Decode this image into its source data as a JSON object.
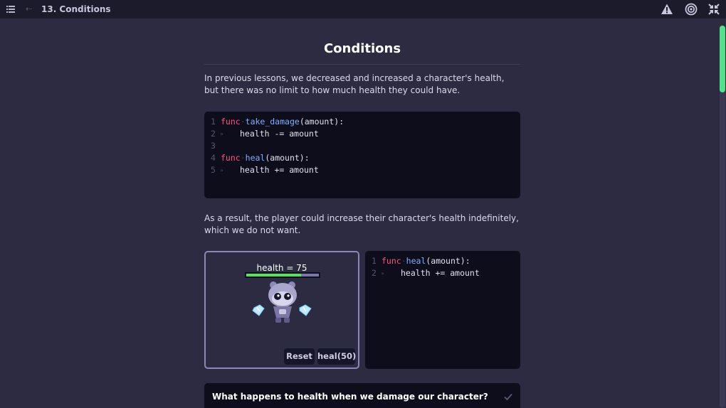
{
  "topbar": {
    "lesson_title": "13. Conditions",
    "menu_icon": "hamburger-menu-icon",
    "back_icon": "arrow-left-icon",
    "warn_icon": "warning-triangle-icon",
    "settings_icon": "gear-icon",
    "fullscreen_icon": "fullscreen-exit-icon"
  },
  "page": {
    "title": "Conditions",
    "para1": "In previous lessons, we decreased and increased a character's health, but there was no limit to how much health they could have.",
    "para2": "As a result, the player could increase their character's health indefinitely, which we do not want."
  },
  "code1": {
    "lines": [
      {
        "n": "1",
        "kw": "func",
        "fn": "take_damage",
        "rest": "(amount):",
        "indent": false
      },
      {
        "n": "2",
        "text": "health -= amount",
        "indent": true
      },
      {
        "n": "3",
        "text": "",
        "indent": false
      },
      {
        "n": "4",
        "kw": "func",
        "fn": "heal",
        "rest": "(amount):",
        "indent": false
      },
      {
        "n": "5",
        "text": "health += amount",
        "indent": true
      }
    ]
  },
  "code2": {
    "lines": [
      {
        "n": "1",
        "kw": "func",
        "fn": "heal",
        "rest": "(amount):",
        "indent": false
      },
      {
        "n": "2",
        "text": "health += amount",
        "indent": true
      }
    ]
  },
  "demo": {
    "health_label": "health = 75",
    "health_fraction": 0.75,
    "reset_label": "Reset",
    "heal_label": "heal(50)"
  },
  "question": {
    "text": "What happens to health when we damage our character?",
    "check_icon": "checkmark-icon"
  },
  "colors": {
    "accent_green": "#58e063",
    "keyword_pink": "#ff4f7a",
    "function_blue": "#7fb0ff",
    "scroll_green": "#55e08a"
  }
}
